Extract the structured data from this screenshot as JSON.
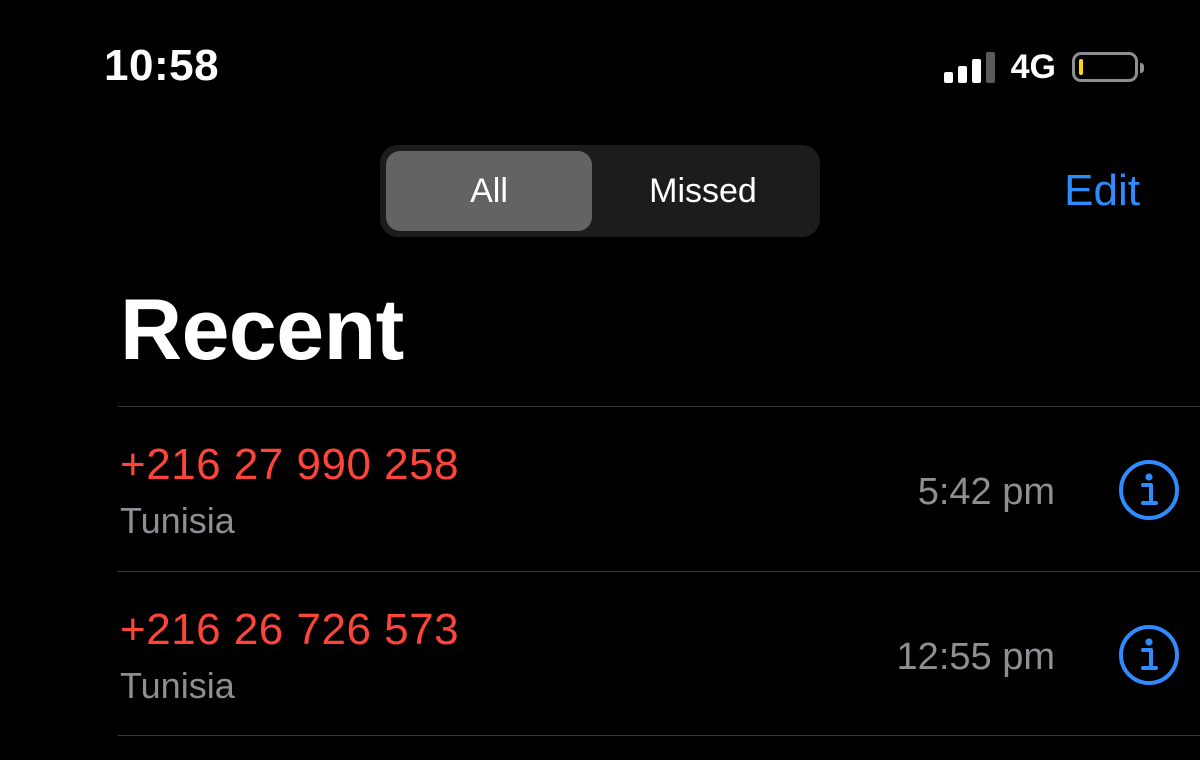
{
  "status_bar": {
    "time": "10:58",
    "network": "4G",
    "signal_bars_active": 3,
    "signal_bars_total": 4,
    "battery_level_fraction": 0.08
  },
  "header": {
    "tabs": [
      {
        "label": "All",
        "selected": true
      },
      {
        "label": "Missed",
        "selected": false
      }
    ],
    "edit_label": "Edit",
    "title": "Recent"
  },
  "calls": [
    {
      "number": "+216 27 990 258",
      "location": "Tunisia",
      "time": "5:42 pm"
    },
    {
      "number": "+216 26 726 573",
      "location": "Tunisia",
      "time": "12:55 pm"
    }
  ],
  "colors": {
    "accent": "#2f8cff",
    "missed": "#ff453a",
    "secondary_text": "#8e8e93",
    "battery_low": "#ffd60a"
  }
}
